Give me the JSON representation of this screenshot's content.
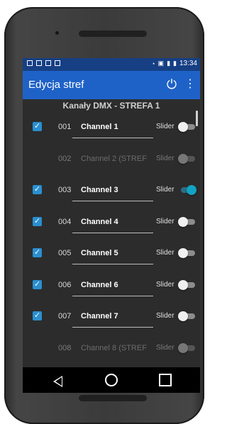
{
  "status_bar": {
    "time": "13:34"
  },
  "app_bar": {
    "title": "Edycja stref"
  },
  "section_title": "Kanały DMX - STREFA 1",
  "channels": [
    {
      "number": "001",
      "name": "Channel 1",
      "slider_label": "Slider",
      "checked": true,
      "slider_on": false,
      "enabled": true
    },
    {
      "number": "002",
      "name": "Channel 2 (STREF",
      "slider_label": "Slider",
      "checked": false,
      "slider_on": false,
      "enabled": false
    },
    {
      "number": "003",
      "name": "Channel 3",
      "slider_label": "Slider",
      "checked": true,
      "slider_on": true,
      "enabled": true
    },
    {
      "number": "004",
      "name": "Channel 4",
      "slider_label": "Slider",
      "checked": true,
      "slider_on": false,
      "enabled": true
    },
    {
      "number": "005",
      "name": "Channel 5",
      "slider_label": "Slider",
      "checked": true,
      "slider_on": false,
      "enabled": true
    },
    {
      "number": "006",
      "name": "Channel 6",
      "slider_label": "Slider",
      "checked": true,
      "slider_on": false,
      "enabled": true
    },
    {
      "number": "007",
      "name": "Channel 7",
      "slider_label": "Slider",
      "checked": true,
      "slider_on": false,
      "enabled": true
    },
    {
      "number": "008",
      "name": "Channel 8 (STREF",
      "slider_label": "Slider",
      "checked": false,
      "slider_on": false,
      "enabled": false
    }
  ],
  "colors": {
    "status_bar": "#163f84",
    "app_bar": "#1f62c7",
    "checkbox": "#2a8fd0",
    "toggle_on": "#11a3c2",
    "background": "#2c2c2c"
  },
  "icons": {
    "power": "power-icon",
    "overflow": "more-vert-icon",
    "back": "back-triangle-icon",
    "home": "home-circle-icon",
    "recents": "recents-square-icon"
  }
}
